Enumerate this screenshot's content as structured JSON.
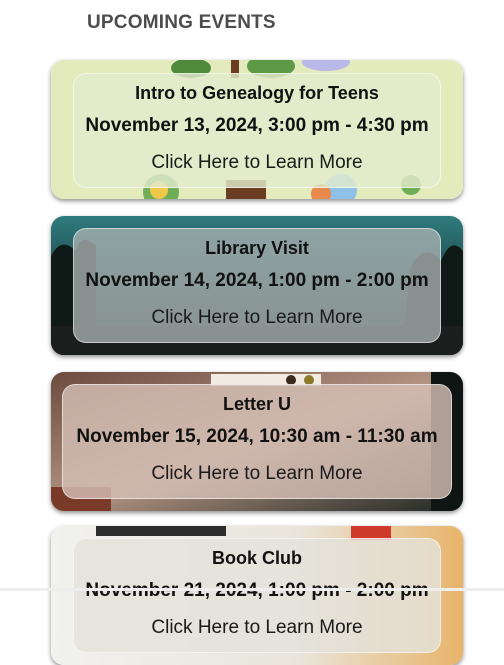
{
  "section": {
    "heading": "UPCOMING EVENTS"
  },
  "events": [
    {
      "title": "Intro to Genealogy for Teens",
      "date": "November 13, 2024, 3:00 pm - 4:30 pm",
      "link": "Click Here to Learn More",
      "accent": "#dfe8b5"
    },
    {
      "title": "Library Visit",
      "date": "November 14, 2024, 1:00 pm - 2:00 pm",
      "link": "Click Here to Learn More",
      "accent": "#2f6f74"
    },
    {
      "title": "Letter U",
      "date": "November 15, 2024, 10:30 am - 11:30 am",
      "link": "Click Here to Learn More",
      "accent": "#c9b2a6"
    },
    {
      "title": "Book Club",
      "date": "November 21, 2024, 1:00 pm - 2:00 pm",
      "link": "Click Here to Learn More",
      "accent": "#e8c58a"
    }
  ]
}
